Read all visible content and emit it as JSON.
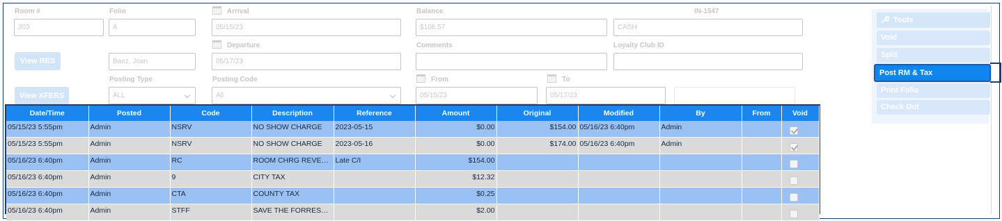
{
  "form": {
    "room_label": "Room #",
    "room_value": "203",
    "folio_label": "Folio",
    "folio_value": "A",
    "arrival_label": "Arrival",
    "arrival_value": "05/15/23",
    "balance_label": "Balance",
    "balance_value": "$168.57",
    "in_label": "IN-1547",
    "in_value": "CASH",
    "view_res_label": "View RES",
    "guest_value": "Baez, Joan",
    "departure_label": "Departure",
    "departure_value": "05/17/23",
    "comments_label": "Comments",
    "comments_value": "",
    "loyalty_label": "Loyalty Club ID",
    "loyalty_value": "",
    "view_xfers_label": "View XFERS",
    "posting_type_label": "Posting Type",
    "posting_type_value": "ALL",
    "posting_code_label": "Posting Code",
    "posting_code_value": "All",
    "from_label": "From",
    "from_value": "05/15/23",
    "to_label": "To",
    "to_value": "05/17/23"
  },
  "tools": {
    "header": "Tools",
    "items": [
      "Void",
      "Split",
      "Post RM & Tax",
      "Print Folio",
      "Check Out"
    ],
    "active_item": "Post RM & Tax"
  },
  "table": {
    "columns": [
      "Date/Time",
      "Posted",
      "Code",
      "Description",
      "Reference",
      "Amount",
      "Original",
      "Modified",
      "By",
      "From",
      "Void"
    ],
    "rows": [
      {
        "datetime": "05/15/23 5:55pm",
        "posted": "Admin",
        "code": "NSRV",
        "description": "NO SHOW CHARGE",
        "reference": "2023-05-15",
        "amount": "$0.00",
        "original": "$154.00",
        "modified": "05/16/23 6:40pm",
        "by": "Admin",
        "from": "",
        "void": true
      },
      {
        "datetime": "05/15/23 5:55pm",
        "posted": "Admin",
        "code": "NSRV",
        "description": "NO SHOW CHARGE",
        "reference": "2023-05-16",
        "amount": "$0.00",
        "original": "$174.00",
        "modified": "05/16/23 6:40pm",
        "by": "Admin",
        "from": "",
        "void": true
      },
      {
        "datetime": "05/16/23 6:40pm",
        "posted": "Admin",
        "code": "RC",
        "description": "ROOM CHRG REVENUE",
        "reference": "Late C/I",
        "amount": "$154.00",
        "original": "",
        "modified": "",
        "by": "",
        "from": "",
        "void": false
      },
      {
        "datetime": "05/16/23 6:40pm",
        "posted": "Admin",
        "code": "9",
        "description": "CITY TAX",
        "reference": "",
        "amount": "$12.32",
        "original": "",
        "modified": "",
        "by": "",
        "from": "",
        "void": false
      },
      {
        "datetime": "05/16/23 6:40pm",
        "posted": "Admin",
        "code": "CTA",
        "description": "COUNTY TAX",
        "reference": "",
        "amount": "$0.25",
        "original": "",
        "modified": "",
        "by": "",
        "from": "",
        "void": false
      },
      {
        "datetime": "05/16/23 6:40pm",
        "posted": "Admin",
        "code": "STFF",
        "description": "SAVE THE FORREST ...",
        "reference": "",
        "amount": "$2.00",
        "original": "",
        "modified": "",
        "by": "",
        "from": "",
        "void": false
      }
    ]
  },
  "colors": {
    "header_blue": "#1a86ee",
    "row_blue": "#99c2f2",
    "row_gray": "#dadada",
    "frame_navy": "#173f73"
  }
}
